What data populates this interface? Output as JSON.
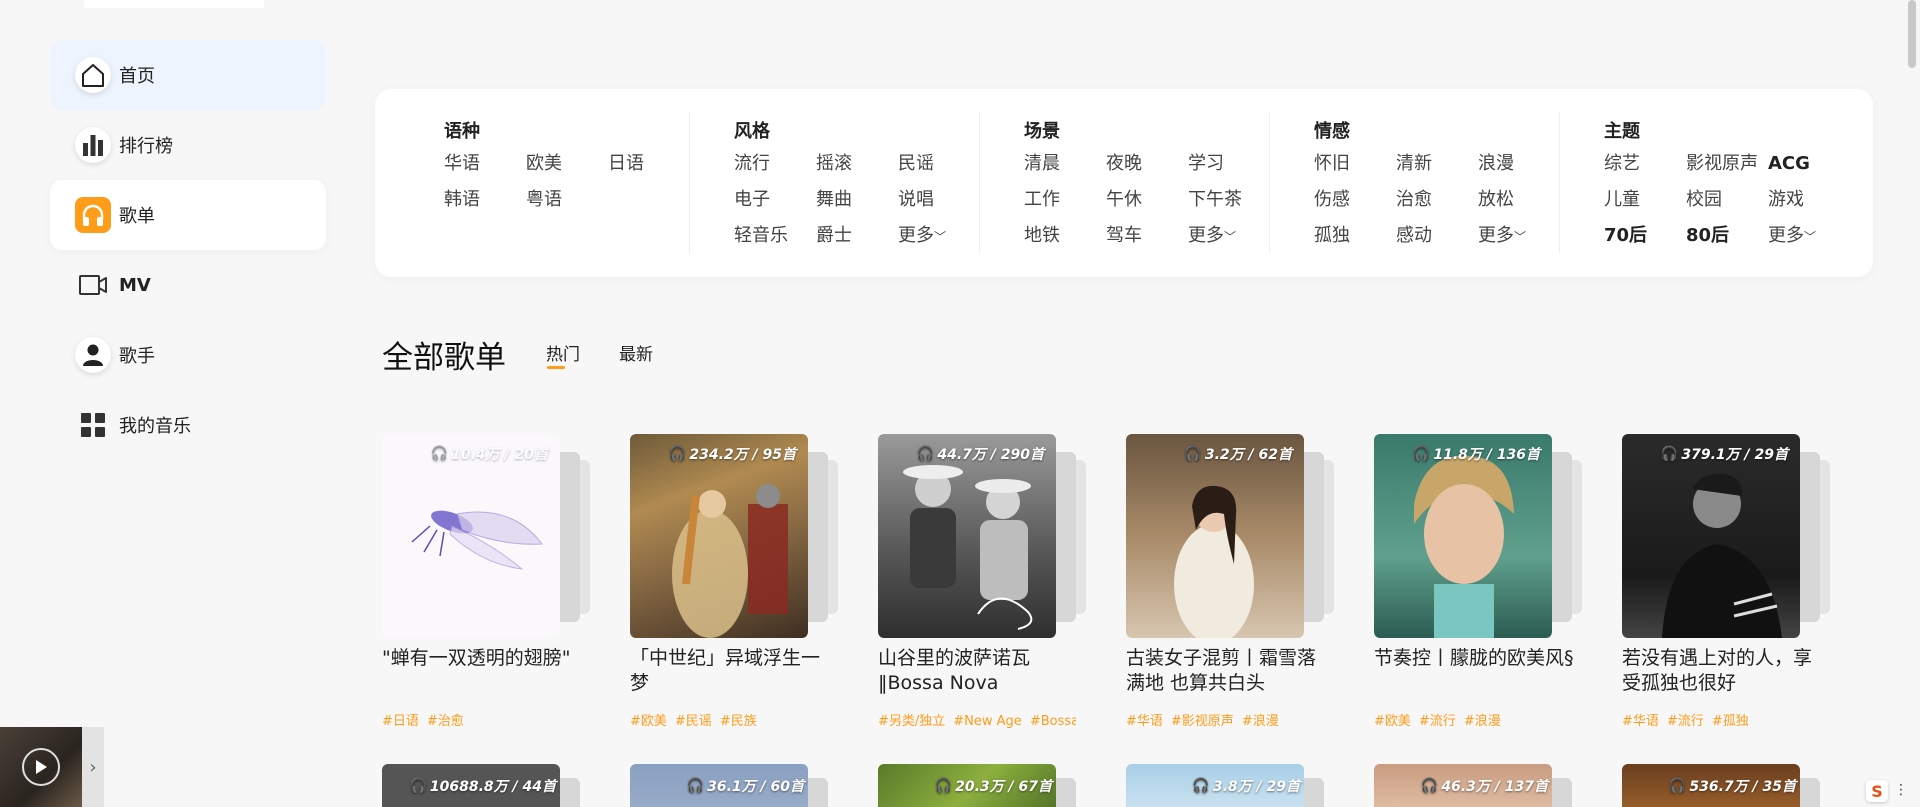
{
  "sidebar": {
    "items": [
      {
        "label": "首页",
        "icon": "home-icon"
      },
      {
        "label": "排行榜",
        "icon": "chart-bars-icon"
      },
      {
        "label": "歌单",
        "icon": "headphones-icon"
      },
      {
        "label": "MV",
        "icon": "video-icon"
      },
      {
        "label": "歌手",
        "icon": "person-icon"
      },
      {
        "label": "我的音乐",
        "icon": "grid-icon"
      }
    ]
  },
  "filters": [
    {
      "title": "语种",
      "tags": [
        "华语",
        "欧美",
        "日语",
        "韩语",
        "粤语"
      ]
    },
    {
      "title": "风格",
      "tags": [
        "流行",
        "摇滚",
        "民谣",
        "电子",
        "舞曲",
        "说唱",
        "轻音乐",
        "爵士",
        "更多"
      ]
    },
    {
      "title": "场景",
      "tags": [
        "清晨",
        "夜晚",
        "学习",
        "工作",
        "午休",
        "下午茶",
        "地铁",
        "驾车",
        "更多"
      ]
    },
    {
      "title": "情感",
      "tags": [
        "怀旧",
        "清新",
        "浪漫",
        "伤感",
        "治愈",
        "放松",
        "孤独",
        "感动",
        "更多"
      ]
    },
    {
      "title": "主题",
      "tags": [
        "综艺",
        "影视原声",
        "ACG",
        "儿童",
        "校园",
        "游戏",
        "70后",
        "80后",
        "更多"
      ]
    }
  ],
  "section": {
    "title": "全部歌单",
    "tabs": [
      "热门",
      "最新"
    ]
  },
  "playlists": [
    {
      "count": "10.4万 / 20首",
      "title": "\"蝉有一双透明的翅膀\"",
      "tags": [
        "#日语",
        "#治愈"
      ]
    },
    {
      "count": "234.2万 / 95首",
      "title": "「中世纪」异域浮生一梦",
      "tags": [
        "#欧美",
        "#民谣",
        "#民族"
      ]
    },
    {
      "count": "44.7万 / 290首",
      "title": "山谷里的波萨诺瓦 ‖Bossa Nova",
      "tags": [
        "#另类/独立",
        "#New Age",
        "#Bossa Nova"
      ]
    },
    {
      "count": "3.2万 / 62首",
      "title": "古装女子混剪丨霜雪落满地 也算共白头",
      "tags": [
        "#华语",
        "#影视原声",
        "#浪漫"
      ]
    },
    {
      "count": "11.8万 / 136首",
      "title": "节奏控丨朦胧的欧美风§",
      "tags": [
        "#欧美",
        "#流行",
        "#浪漫"
      ]
    },
    {
      "count": "379.1万 / 29首",
      "title": "若没有遇上对的人，享受孤独也很好",
      "tags": [
        "#华语",
        "#流行",
        "#孤独"
      ]
    }
  ],
  "playlists_row2": [
    {
      "count": "10688.8万 / 44首"
    },
    {
      "count": "36.1万 / 60首"
    },
    {
      "count": "20.3万 / 67首"
    },
    {
      "count": "3.8万 / 29首"
    },
    {
      "count": "46.3万 / 137首"
    },
    {
      "count": "536.7万 / 35首"
    }
  ],
  "mini_player": {
    "expand_icon": "chevron-right-icon"
  },
  "ime": {
    "label": "S",
    "dots": "⋮"
  },
  "colors": {
    "accent": "#ff9c1a",
    "home_bg": "#edf4fd"
  }
}
